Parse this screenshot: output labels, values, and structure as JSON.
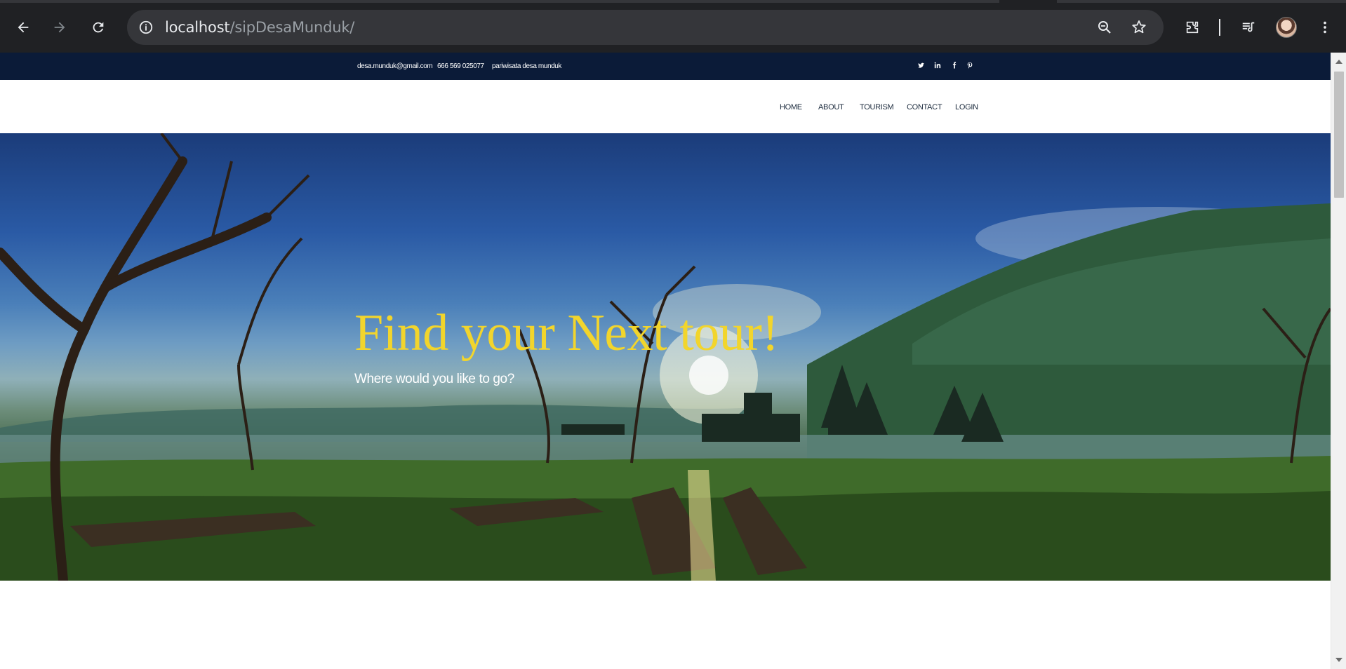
{
  "browser": {
    "url_host": "localhost",
    "url_path": "/sipDesaMunduk/",
    "icons": [
      "back-arrow-icon",
      "forward-arrow-icon",
      "reload-icon",
      "site-info-icon",
      "zoom-icon",
      "bookmark-star-icon",
      "extensions-icon",
      "media-control-icon",
      "profile-avatar",
      "menu-kebab-icon"
    ]
  },
  "topbar": {
    "email": "desa.munduk@gmail.com",
    "phone": "666 569 025077",
    "tagline": "pariwisata desa munduk",
    "social": [
      {
        "name": "twitter-icon",
        "glyph": "t"
      },
      {
        "name": "linkedin-icon",
        "glyph": "in"
      },
      {
        "name": "facebook-icon",
        "glyph": "f"
      },
      {
        "name": "pinterest-icon",
        "glyph": "p"
      }
    ],
    "bg_color": "#0b1b38"
  },
  "nav": {
    "items": [
      "HOME",
      "ABOUT",
      "TOURISM",
      "CONTACT",
      "LOGIN"
    ]
  },
  "hero": {
    "title_part1": "Find your",
    "title_part2": "Next tour!",
    "subtitle": "Where would you like to go?",
    "title_color": "#f2d52c",
    "highlight_color": "#2cb5a8"
  }
}
